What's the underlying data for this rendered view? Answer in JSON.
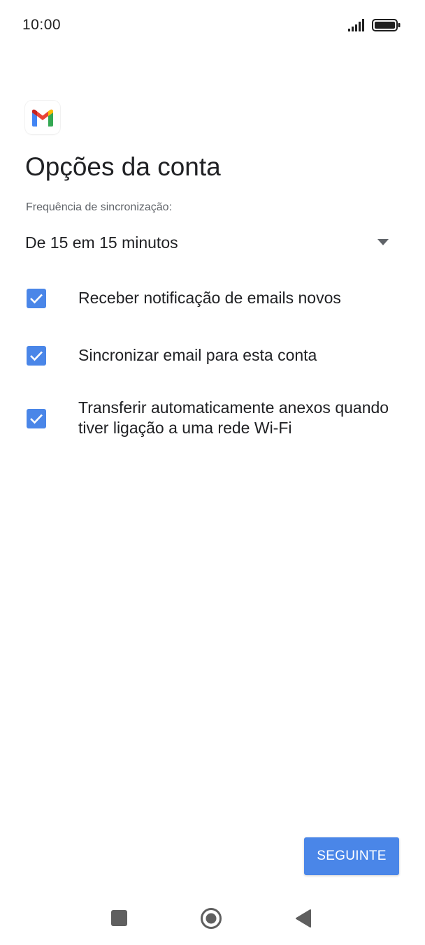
{
  "status_bar": {
    "time": "10:00"
  },
  "app": {
    "logo_icon": "gmail-icon"
  },
  "page": {
    "title": "Opções da conta"
  },
  "sync": {
    "label": "Frequência de sincronização:",
    "selected": "De 15 em 15 minutos"
  },
  "options": [
    {
      "label": "Receber notificação de emails novos",
      "checked": true
    },
    {
      "label": "Sincronizar email para esta conta",
      "checked": true
    },
    {
      "label": "Transferir automaticamente anexos quando tiver ligação a uma rede Wi-Fi",
      "checked": true
    }
  ],
  "footer": {
    "next_label": "SEGUINTE"
  },
  "colors": {
    "accent": "#4a86e8",
    "text": "#202124",
    "muted": "#5f6368"
  },
  "nav": {
    "icons": [
      "recent-apps-icon",
      "home-icon",
      "back-icon"
    ]
  }
}
